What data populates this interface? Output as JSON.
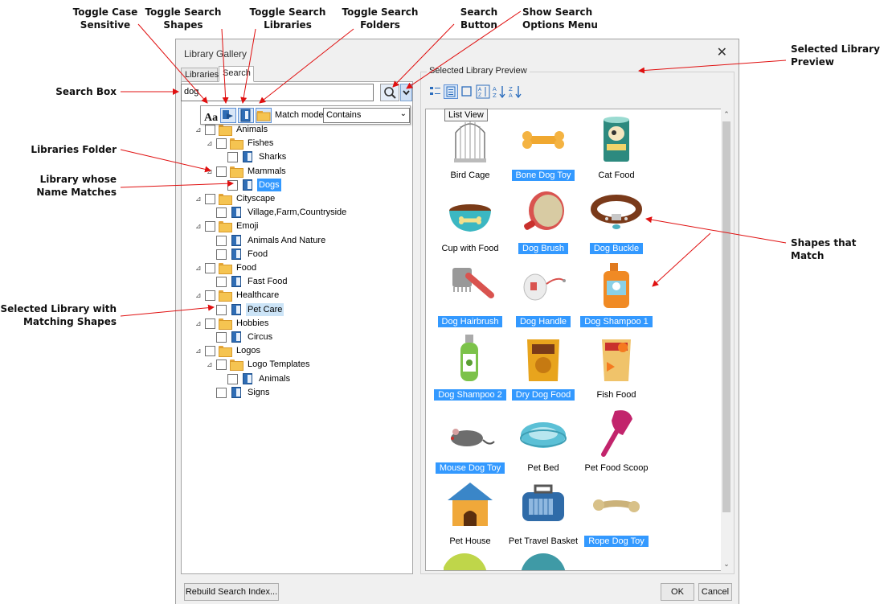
{
  "annotations": {
    "toggle_case": "Toggle Case\nSensitive",
    "toggle_shapes": "Toggle Search\nShapes",
    "toggle_libraries": "Toggle Search\nLibraries",
    "toggle_folders": "Toggle Search\nFolders",
    "search_button": "Search\nButton",
    "show_options": "Show Search\nOptions Menu",
    "selected_preview": "Selected Library\nPreview",
    "search_box": "Search Box",
    "libraries_folder": "Libraries Folder",
    "library_name_matches": "Library whose\nName Matches",
    "selected_library_matching": "Selected Library with\nMatching Shapes",
    "shapes_that_match": "Shapes that Match"
  },
  "dialog": {
    "title": "Library Gallery",
    "close": "✕",
    "tabs": [
      "Libraries",
      "Search"
    ],
    "search_value": "dog",
    "match_mode_label": "Match mode:",
    "match_mode_value": "Contains",
    "preview_title": "Selected Library Preview",
    "tooltip": "List View",
    "rebuild_button": "Rebuild Search Index...",
    "ok_button": "OK",
    "cancel_button": "Cancel"
  },
  "tree": [
    {
      "label": "Animals",
      "type": "folder",
      "level": 1,
      "expanded": true
    },
    {
      "label": "Fishes",
      "type": "folder",
      "level": 2,
      "expanded": true
    },
    {
      "label": "Sharks",
      "type": "library",
      "level": 3
    },
    {
      "label": "Mammals",
      "type": "folder",
      "level": 2,
      "expanded": true
    },
    {
      "label": "Dogs",
      "type": "library",
      "level": 3,
      "state": "selected"
    },
    {
      "label": "Cityscape",
      "type": "folder",
      "level": 1,
      "expanded": true
    },
    {
      "label": "Village,Farm,Countryside",
      "type": "library",
      "level": 2
    },
    {
      "label": "Emoji",
      "type": "folder",
      "level": 1,
      "expanded": true
    },
    {
      "label": "Animals And Nature",
      "type": "library",
      "level": 2
    },
    {
      "label": "Food",
      "type": "library",
      "level": 2
    },
    {
      "label": "Food",
      "type": "folder",
      "level": 1,
      "expanded": true
    },
    {
      "label": "Fast Food",
      "type": "library",
      "level": 2
    },
    {
      "label": "Healthcare",
      "type": "folder",
      "level": 1,
      "expanded": true
    },
    {
      "label": "Pet Care",
      "type": "library",
      "level": 2,
      "state": "highlighted"
    },
    {
      "label": "Hobbies",
      "type": "folder",
      "level": 1,
      "expanded": true
    },
    {
      "label": "Circus",
      "type": "library",
      "level": 2
    },
    {
      "label": "Logos",
      "type": "folder",
      "level": 1,
      "expanded": true
    },
    {
      "label": "Logo Templates",
      "type": "folder",
      "level": 2,
      "expanded": true
    },
    {
      "label": "Animals",
      "type": "library",
      "level": 3
    },
    {
      "label": "Signs",
      "type": "library",
      "level": 2
    }
  ],
  "shapes": [
    {
      "label": "Bird Cage",
      "selected": false,
      "icon": "bird-cage-icon"
    },
    {
      "label": "Bone Dog Toy",
      "selected": true,
      "icon": "bone-toy-icon"
    },
    {
      "label": "Cat Food",
      "selected": false,
      "icon": "cat-food-can-icon"
    },
    {
      "label": "Cup with Food",
      "selected": false,
      "icon": "food-bowl-icon"
    },
    {
      "label": "Dog Brush",
      "selected": true,
      "icon": "dog-brush-icon"
    },
    {
      "label": "Dog Buckle",
      "selected": true,
      "icon": "dog-collar-icon"
    },
    {
      "label": "Dog Hairbrush",
      "selected": true,
      "icon": "hairbrush-icon"
    },
    {
      "label": "Dog Handle",
      "selected": true,
      "icon": "leash-handle-icon"
    },
    {
      "label": "Dog Shampoo 1",
      "selected": true,
      "icon": "shampoo-bottle-icon"
    },
    {
      "label": "Dog Shampoo 2",
      "selected": true,
      "icon": "shampoo-bottle-green-icon"
    },
    {
      "label": "Dry Dog Food",
      "selected": true,
      "icon": "dog-food-bag-icon"
    },
    {
      "label": "Fish Food",
      "selected": false,
      "icon": "fish-food-bag-icon"
    },
    {
      "label": "Mouse Dog Toy",
      "selected": true,
      "icon": "toy-mouse-icon"
    },
    {
      "label": "Pet Bed",
      "selected": false,
      "icon": "pet-bed-icon"
    },
    {
      "label": "Pet Food Scoop",
      "selected": false,
      "icon": "scoop-icon"
    },
    {
      "label": "Pet House",
      "selected": false,
      "icon": "dog-house-icon"
    },
    {
      "label": "Pet Travel Basket",
      "selected": false,
      "icon": "pet-carrier-icon"
    },
    {
      "label": "Rope Dog Toy",
      "selected": true,
      "icon": "rope-toy-icon"
    }
  ]
}
